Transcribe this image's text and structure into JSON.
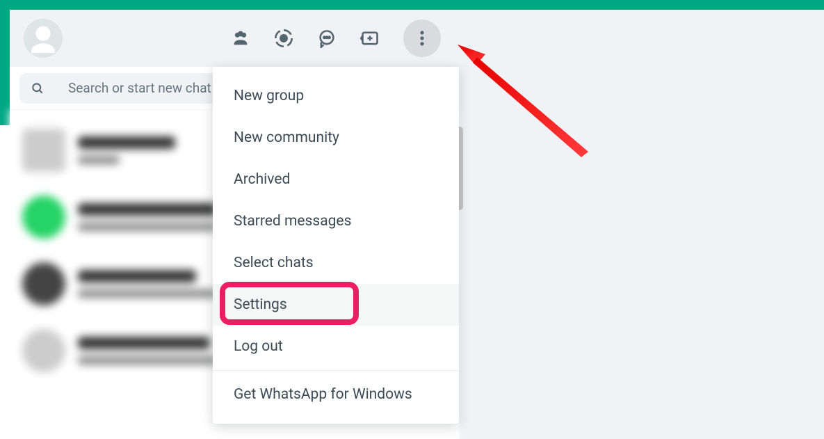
{
  "search": {
    "placeholder": "Search or start new chat"
  },
  "menu": {
    "items": [
      {
        "label": "New group"
      },
      {
        "label": "New community"
      },
      {
        "label": "Archived"
      },
      {
        "label": "Starred messages"
      },
      {
        "label": "Select chats"
      },
      {
        "label": "Settings"
      },
      {
        "label": "Log out"
      }
    ],
    "footer": "Get WhatsApp for Windows",
    "highlighted_index": 5
  },
  "colors": {
    "brand": "#00a884",
    "highlight": "#e91e63"
  }
}
